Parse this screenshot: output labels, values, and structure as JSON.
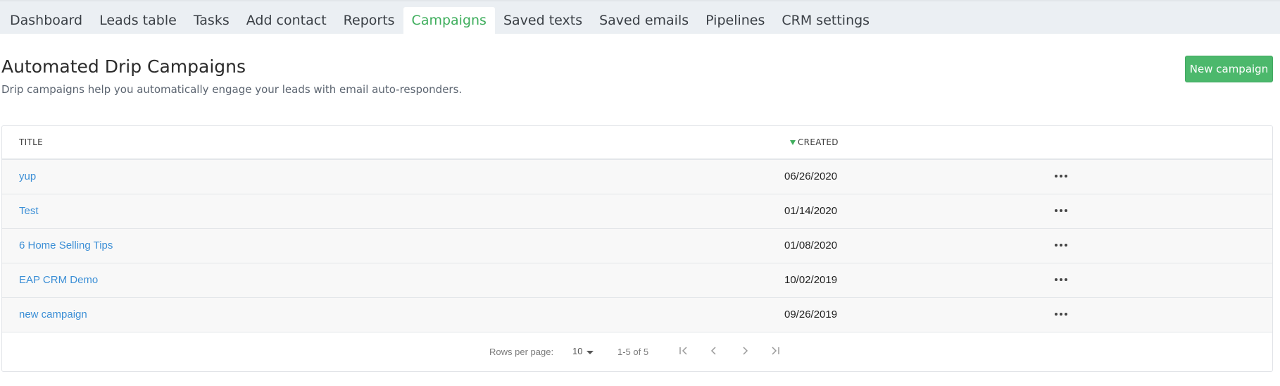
{
  "tabs": [
    {
      "label": "Dashboard",
      "active": false
    },
    {
      "label": "Leads table",
      "active": false
    },
    {
      "label": "Tasks",
      "active": false
    },
    {
      "label": "Add contact",
      "active": false
    },
    {
      "label": "Reports",
      "active": false
    },
    {
      "label": "Campaigns",
      "active": true
    },
    {
      "label": "Saved texts",
      "active": false
    },
    {
      "label": "Saved emails",
      "active": false
    },
    {
      "label": "Pipelines",
      "active": false
    },
    {
      "label": "CRM settings",
      "active": false
    }
  ],
  "header": {
    "title": "Automated Drip Campaigns",
    "subtitle": "Drip campaigns help you automatically engage your leads with email auto-responders.",
    "new_button_label": "New campaign"
  },
  "table": {
    "columns": {
      "title": "TITLE",
      "created": "CREATED"
    },
    "sort": {
      "column": "created",
      "direction": "desc",
      "icon": "sort-desc-icon"
    },
    "rows": [
      {
        "title": "yup",
        "created": "06/26/2020"
      },
      {
        "title": "Test",
        "created": "01/14/2020"
      },
      {
        "title": "6 Home Selling Tips",
        "created": "01/08/2020"
      },
      {
        "title": "EAP CRM Demo",
        "created": "10/02/2019"
      },
      {
        "title": "new campaign",
        "created": "09/26/2019"
      }
    ],
    "row_menu_icon": "more-horizontal-icon"
  },
  "pagination": {
    "rows_per_page_label": "Rows per page:",
    "rows_per_page_value": "10",
    "range_text": "1-5 of 5",
    "icons": [
      "first-page-icon",
      "previous-page-icon",
      "next-page-icon",
      "last-page-icon"
    ]
  },
  "colors": {
    "accent": "#3fae5d",
    "button": "#4cb86c",
    "link": "#3c8fd6",
    "tabbar_bg": "#ebeff3",
    "row_bg": "#f8f8f8"
  }
}
